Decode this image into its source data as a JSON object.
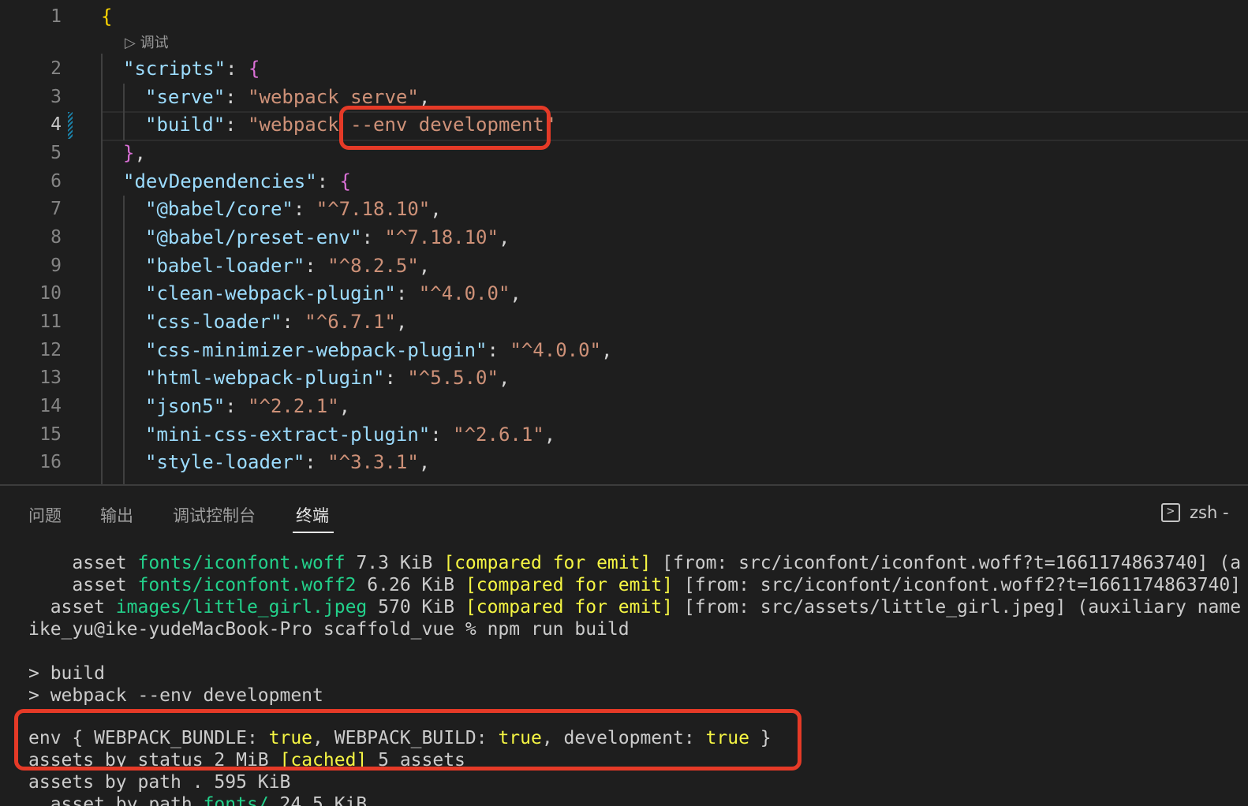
{
  "editor": {
    "codelens": "▷ 调试",
    "lines": [
      {
        "n": "1",
        "segs": [
          [
            "b1",
            "{"
          ]
        ]
      },
      {
        "n": "2",
        "segs": [
          [
            "k",
            "\"scripts\""
          ],
          [
            "p",
            ": "
          ],
          [
            "b2",
            "{"
          ]
        ]
      },
      {
        "n": "3",
        "segs": [
          [
            "k",
            "\"serve\""
          ],
          [
            "p",
            ": "
          ],
          [
            "s",
            "\"webpack serve\""
          ],
          [
            "p",
            ","
          ]
        ]
      },
      {
        "n": "4",
        "segs": [
          [
            "k",
            "\"build\""
          ],
          [
            "p",
            ": "
          ],
          [
            "s",
            "\"webpack --env development\""
          ]
        ]
      },
      {
        "n": "5",
        "segs": [
          [
            "b2",
            "}"
          ],
          [
            "p",
            ","
          ]
        ]
      },
      {
        "n": "6",
        "segs": [
          [
            "k",
            "\"devDependencies\""
          ],
          [
            "p",
            ": "
          ],
          [
            "b2",
            "{"
          ]
        ]
      },
      {
        "n": "7",
        "segs": [
          [
            "k",
            "\"@babel/core\""
          ],
          [
            "p",
            ": "
          ],
          [
            "s",
            "\"^7.18.10\""
          ],
          [
            "p",
            ","
          ]
        ]
      },
      {
        "n": "8",
        "segs": [
          [
            "k",
            "\"@babel/preset-env\""
          ],
          [
            "p",
            ": "
          ],
          [
            "s",
            "\"^7.18.10\""
          ],
          [
            "p",
            ","
          ]
        ]
      },
      {
        "n": "9",
        "segs": [
          [
            "k",
            "\"babel-loader\""
          ],
          [
            "p",
            ": "
          ],
          [
            "s",
            "\"^8.2.5\""
          ],
          [
            "p",
            ","
          ]
        ]
      },
      {
        "n": "10",
        "segs": [
          [
            "k",
            "\"clean-webpack-plugin\""
          ],
          [
            "p",
            ": "
          ],
          [
            "s",
            "\"^4.0.0\""
          ],
          [
            "p",
            ","
          ]
        ]
      },
      {
        "n": "11",
        "segs": [
          [
            "k",
            "\"css-loader\""
          ],
          [
            "p",
            ": "
          ],
          [
            "s",
            "\"^6.7.1\""
          ],
          [
            "p",
            ","
          ]
        ]
      },
      {
        "n": "12",
        "segs": [
          [
            "k",
            "\"css-minimizer-webpack-plugin\""
          ],
          [
            "p",
            ": "
          ],
          [
            "s",
            "\"^4.0.0\""
          ],
          [
            "p",
            ","
          ]
        ]
      },
      {
        "n": "13",
        "segs": [
          [
            "k",
            "\"html-webpack-plugin\""
          ],
          [
            "p",
            ": "
          ],
          [
            "s",
            "\"^5.5.0\""
          ],
          [
            "p",
            ","
          ]
        ]
      },
      {
        "n": "14",
        "segs": [
          [
            "k",
            "\"json5\""
          ],
          [
            "p",
            ": "
          ],
          [
            "s",
            "\"^2.2.1\""
          ],
          [
            "p",
            ","
          ]
        ]
      },
      {
        "n": "15",
        "segs": [
          [
            "k",
            "\"mini-css-extract-plugin\""
          ],
          [
            "p",
            ": "
          ],
          [
            "s",
            "\"^2.6.1\""
          ],
          [
            "p",
            ","
          ]
        ]
      },
      {
        "n": "16",
        "segs": [
          [
            "k",
            "\"style-loader\""
          ],
          [
            "p",
            ": "
          ],
          [
            "s",
            "\"^3.3.1\""
          ],
          [
            "p",
            ","
          ]
        ]
      }
    ]
  },
  "panel": {
    "tabs": [
      "问题",
      "输出",
      "调试控制台",
      "终端"
    ],
    "active_tab": "终端",
    "shell": "zsh -"
  },
  "terminal": {
    "lines": [
      {
        "segs": [
          [
            "",
            "    asset "
          ],
          [
            "g",
            "fonts/iconfont.woff"
          ],
          [
            "",
            " 7.3 KiB "
          ],
          [
            "y",
            "[compared for emit]"
          ],
          [
            "",
            " [from: src/iconfont/iconfont.woff?t=1661174863740] (a"
          ]
        ]
      },
      {
        "segs": [
          [
            "",
            "    asset "
          ],
          [
            "g",
            "fonts/iconfont.woff2"
          ],
          [
            "",
            " 6.26 KiB "
          ],
          [
            "y",
            "[compared for emit]"
          ],
          [
            "",
            " [from: src/iconfont/iconfont.woff2?t=1661174863740]"
          ]
        ]
      },
      {
        "segs": [
          [
            "",
            "  asset "
          ],
          [
            "g",
            "images/little_girl.jpeg"
          ],
          [
            "",
            " 570 KiB "
          ],
          [
            "y",
            "[compared for emit]"
          ],
          [
            "",
            " [from: src/assets/little_girl.jpeg] (auxiliary name"
          ]
        ]
      },
      {
        "segs": [
          [
            "",
            "ike_yu@ike-yudeMacBook-Pro scaffold_vue % npm run build"
          ]
        ]
      },
      {
        "segs": [
          [
            "",
            ""
          ]
        ]
      },
      {
        "segs": [
          [
            "",
            "> build"
          ]
        ]
      },
      {
        "segs": [
          [
            "",
            "> webpack --env development"
          ]
        ]
      },
      {
        "segs": [
          [
            "",
            ""
          ]
        ]
      },
      {
        "segs": [
          [
            "",
            "env { WEBPACK_BUNDLE: "
          ],
          [
            "y",
            "true"
          ],
          [
            "",
            ", WEBPACK_BUILD: "
          ],
          [
            "y",
            "true"
          ],
          [
            "",
            ", development: "
          ],
          [
            "y",
            "true"
          ],
          [
            "",
            " }"
          ]
        ]
      },
      {
        "segs": [
          [
            "",
            "assets by status 2 MiB "
          ],
          [
            "y",
            "[cached]"
          ],
          [
            "",
            " 5 assets"
          ]
        ]
      },
      {
        "segs": [
          [
            "",
            "assets by path . 595 KiB"
          ]
        ]
      },
      {
        "segs": [
          [
            "",
            "  asset by path "
          ],
          [
            "g",
            "fonts/"
          ],
          [
            "",
            " 24.5 KiB"
          ]
        ]
      }
    ]
  },
  "colors": {
    "highlight_box": "#e53a27",
    "string": "#ce9178",
    "key": "#9cdcfe",
    "terminal_green": "#23d18b",
    "terminal_yellow": "#f5f543"
  }
}
